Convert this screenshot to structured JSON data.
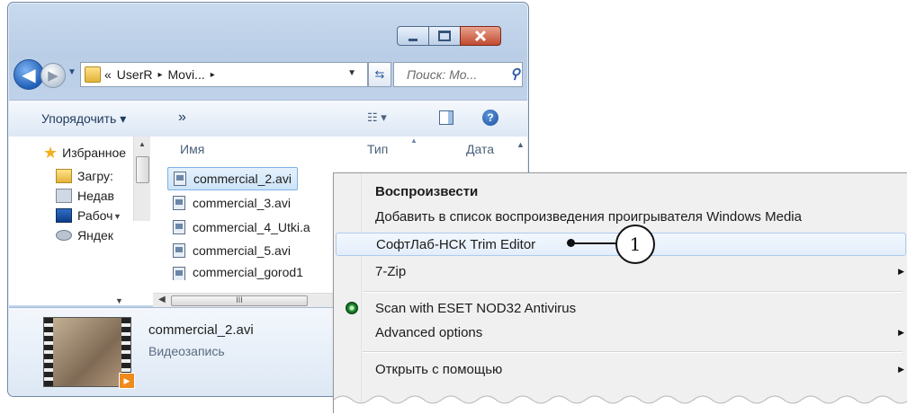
{
  "explorer": {
    "caption_buttons": [
      "minimize",
      "maximize",
      "close"
    ],
    "address": {
      "overflow": "«",
      "crumbs": [
        "UserR",
        "Movi..."
      ],
      "separator": "▸"
    },
    "search_placeholder": "Поиск: Mo...",
    "toolbar": {
      "organize": "Упорядочить ▾",
      "more": "»",
      "views": "☷ ▾"
    },
    "nav_items": [
      {
        "label": "Избранное",
        "icon": "star-icon"
      },
      {
        "label": "Загру:",
        "icon": "downloads-icon"
      },
      {
        "label": "Недав",
        "icon": "recent-icon"
      },
      {
        "label": "Рабоч",
        "icon": "desktop-icon"
      },
      {
        "label": "Яндек",
        "icon": "yandex-disk-icon"
      }
    ],
    "columns": {
      "name": "Имя",
      "type": "Тип",
      "date": "Дата"
    },
    "files": [
      "commercial_2.avi",
      "commercial_3.avi",
      "commercial_4_Utki.a",
      "commercial_5.avi",
      "commercial_gorod1"
    ],
    "selected_file": "commercial_2.avi",
    "hscroll_grip": "III",
    "details": {
      "name": "commercial_2.avi",
      "type": "Видеозапись"
    }
  },
  "context_menu": {
    "items": {
      "play": "Воспроизвести",
      "add_playlist": "Добавить в список воспроизведения проигрывателя Windows Media",
      "trim_editor": "СофтЛаб-НСК Trim Editor",
      "sevenzip": "7-Zip",
      "eset": "Scan with ESET NOD32 Antivirus",
      "advanced": "Advanced options",
      "open_with": "Открыть с помощью"
    },
    "submenu_arrow": "▶"
  },
  "callout": {
    "number": "1"
  }
}
